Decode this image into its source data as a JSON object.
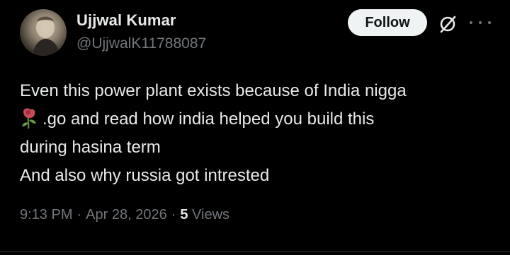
{
  "author": {
    "display_name": "Ujjwal Kumar",
    "handle": "@UjjwalK11788087"
  },
  "actions": {
    "follow_label": "Follow",
    "grok_icon": "grok-icon",
    "more_icon": "more-icon"
  },
  "tweet": {
    "lines": [
      "Even this power plant exists because of India nigga",
      ".go and read how india helped you build this",
      "during hasina term",
      "And also why russia got intrested"
    ],
    "emoji": "wilted-rose-emoji"
  },
  "meta": {
    "time": "9:13 PM",
    "date": "Apr 28, 2026",
    "separator": "·",
    "views_count": "5",
    "views_label": "Views"
  },
  "colors": {
    "background": "#000000",
    "text_primary": "#e7e9ea",
    "text_secondary": "#71767b",
    "follow_bg": "#eff3f4",
    "follow_text": "#0f1419"
  }
}
